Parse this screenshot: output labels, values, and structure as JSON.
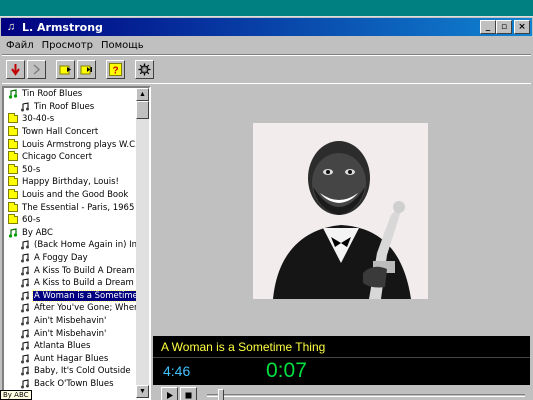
{
  "window": {
    "title": "L. Armstrong",
    "buttons": {
      "minimize": "_",
      "maximize": "▫",
      "close": "×"
    }
  },
  "menu": [
    "Файл",
    "Просмотр",
    "Помощь"
  ],
  "toolbar": {
    "icons": [
      "record-icon",
      "skip-icon",
      "play-folder-icon",
      "next-folder-icon",
      "help-icon",
      "settings-icon"
    ]
  },
  "tree": {
    "items": [
      {
        "label": "Tin Roof Blues",
        "type": "album-open",
        "indent": 1
      },
      {
        "label": "Tin Roof Blues",
        "type": "track",
        "indent": 2
      },
      {
        "label": "30-40-s",
        "type": "folder",
        "indent": 1
      },
      {
        "label": "Town Hall Concert",
        "type": "folder",
        "indent": 1
      },
      {
        "label": "Louis Armstrong plays W.C.Handy",
        "type": "folder",
        "indent": 1
      },
      {
        "label": "Chicago Concert",
        "type": "folder",
        "indent": 1
      },
      {
        "label": "50-s",
        "type": "folder",
        "indent": 1
      },
      {
        "label": "Happy Birthday, Louis!",
        "type": "folder",
        "indent": 1
      },
      {
        "label": "Louis and the Good Book",
        "type": "folder",
        "indent": 1
      },
      {
        "label": "The Essential - Paris, 1965",
        "type": "folder",
        "indent": 1
      },
      {
        "label": "60-s",
        "type": "folder",
        "indent": 1
      },
      {
        "label": "By ABC",
        "type": "album-open",
        "indent": 1
      },
      {
        "label": "(Back Home Again in) Indiana",
        "type": "track",
        "indent": 2
      },
      {
        "label": "A Foggy Day",
        "type": "track",
        "indent": 2
      },
      {
        "label": "A Kiss To Build A Dream On",
        "type": "track",
        "indent": 2
      },
      {
        "label": "A Kiss to Build a Dream On",
        "type": "track",
        "indent": 2
      },
      {
        "label": "A Woman is a Sometime Thing",
        "type": "track",
        "indent": 2,
        "selected": true
      },
      {
        "label": "After You've Gone; When the",
        "type": "track",
        "indent": 2
      },
      {
        "label": "Ain't Misbehavin'",
        "type": "track",
        "indent": 2
      },
      {
        "label": "Ain't Misbehavin'",
        "type": "track",
        "indent": 2
      },
      {
        "label": "Atlanta Blues",
        "type": "track",
        "indent": 2
      },
      {
        "label": "Aunt Hagar Blues",
        "type": "track",
        "indent": 2
      },
      {
        "label": "Baby, It's Cold Outside",
        "type": "track",
        "indent": 2
      },
      {
        "label": "Back O'Town Blues",
        "type": "track",
        "indent": 2
      }
    ]
  },
  "tooltip": "By ABC",
  "player": {
    "now_playing": "A Woman is a Sometime Thing",
    "duration": "4:46",
    "elapsed": "0:07",
    "progress": 0.024,
    "accent_colors": {
      "title": "#ffff40",
      "duration": "#40c0ff",
      "elapsed": "#00e040"
    }
  }
}
